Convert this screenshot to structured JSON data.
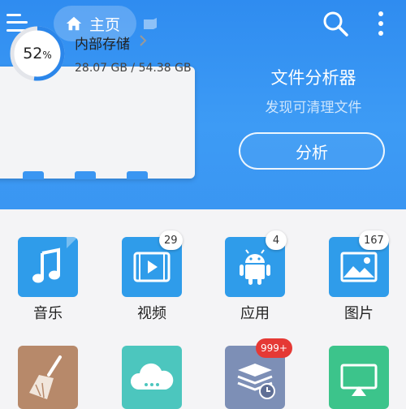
{
  "header": {
    "home_label": "主页"
  },
  "storage": {
    "title": "内部存储",
    "usage": "28.07 GB / 54.38 GB",
    "percent_num": "52",
    "percent_sign": "%",
    "percent_value": 52
  },
  "analyzer": {
    "title": "文件分析器",
    "subtitle": "发现可清理文件",
    "button": "分析"
  },
  "categories": [
    {
      "label": "音乐",
      "icon": "music-note-icon",
      "badge": ""
    },
    {
      "label": "视频",
      "icon": "video-icon",
      "badge": "29"
    },
    {
      "label": "应用",
      "icon": "android-icon",
      "badge": "4"
    },
    {
      "label": "图片",
      "icon": "image-icon",
      "badge": "167"
    }
  ],
  "row2": [
    {
      "icon": "cleaner-broom-icon",
      "badge": ""
    },
    {
      "icon": "cloud-icon",
      "badge": ""
    },
    {
      "icon": "stack-clock-icon",
      "badge": "999+"
    },
    {
      "icon": "cast-screen-icon",
      "badge": ""
    }
  ],
  "colors": {
    "header_blue": "#3a96f2",
    "tile_blue": "#2f9cea",
    "tile_brown": "#b7896a",
    "tile_teal": "#4cc6be",
    "tile_slate": "#7d8fb6",
    "tile_green": "#3cc48b",
    "badge_red": "#e53935"
  }
}
